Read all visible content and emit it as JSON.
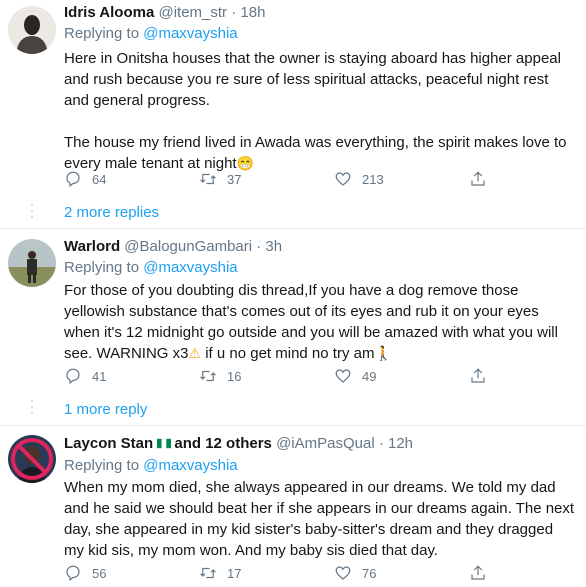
{
  "tweets": [
    {
      "name": "Idris Alooma",
      "handle": "@item_str",
      "time": "· 18h",
      "replying_prefix": "Replying to ",
      "replying_link": "@maxvayshia",
      "para1": "Here in Onitsha houses that the owner is staying aboard has higher appeal and rush because you re sure of less spiritual attacks, peaceful night rest and general progress.",
      "para2": "The house my friend lived in Awada was everything, the spirit makes love to every male tenant at night",
      "emoji": "😁",
      "reply_count": "64",
      "retweet_count": "37",
      "like_count": "213",
      "more_replies": "2 more replies"
    },
    {
      "name": "Warlord",
      "handle": "@BalogunGambari",
      "time": "· 3h",
      "replying_prefix": "Replying to ",
      "replying_link": "@maxvayshia",
      "para1": "For those of you doubting dis thread,If you have a dog remove those yellowish substance that's comes out of its eyes and rub it on your eyes when it's 12 midnight go outside and you will be amazed with what you will see. WARNING x3",
      "warning_emoji": "⚠",
      "para1_tail": " if u no get mind no try am",
      "walk_emoji": "🚶",
      "reply_count": "41",
      "retweet_count": "16",
      "like_count": "49",
      "more_replies": "1 more reply"
    },
    {
      "name": "Laycon Stan",
      "name_suffix": "and 12 others",
      "handle": "@iAmPasQual",
      "time": "· 12h",
      "replying_prefix": "Replying to ",
      "replying_link": "@maxvayshia",
      "para1": "When my mom died, she always appeared in our dreams. We told my dad and he said we should beat her if she appears in our dreams again. The next day,  she appeared in my kid sister's baby-sitter's dream and they dragged my kid sis, my mom won. And my baby sis died that day.",
      "reply_count": "56",
      "retweet_count": "17",
      "like_count": "76"
    }
  ],
  "icons": {
    "reply": "reply-icon",
    "retweet": "retweet-icon",
    "like": "like-icon",
    "share": "share-icon"
  },
  "colors": {
    "link": "#1da1f2",
    "secondary": "#657786",
    "divider": "#e6ecf0"
  }
}
